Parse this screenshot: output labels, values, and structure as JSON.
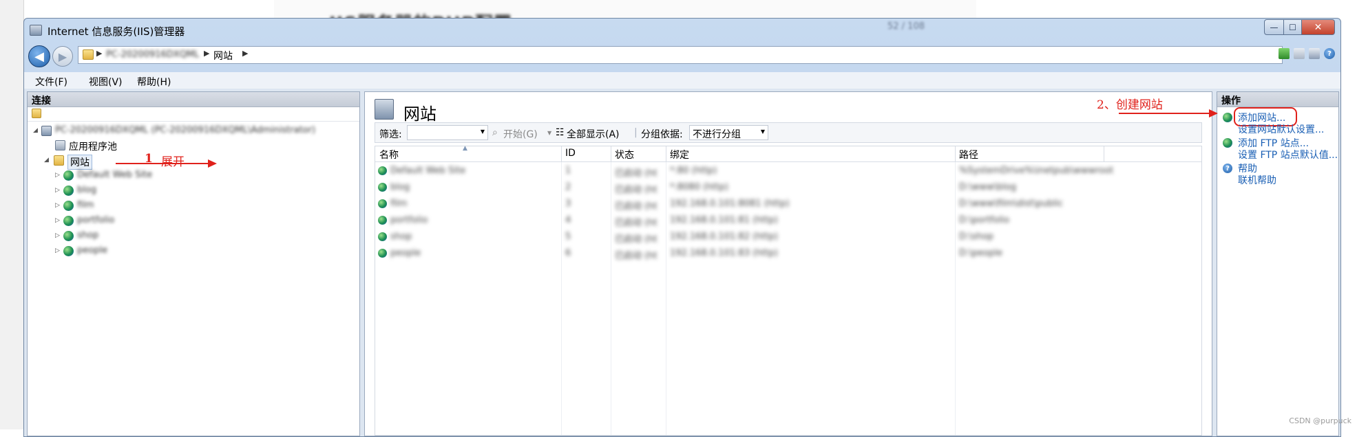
{
  "background": {
    "doc_title": "IIS服务器的PHP配置",
    "doc_page": "52 / 108"
  },
  "window": {
    "title": "Internet 信息服务(IIS)管理器",
    "buttons": {
      "minimize": "—",
      "maximize": "☐",
      "close": "✕"
    }
  },
  "address": {
    "pc_name": "PC-20200916DXQML",
    "site": "网站"
  },
  "menu": {
    "file": "文件(F)",
    "view": "视图(V)",
    "help": "帮助(H)"
  },
  "connections": {
    "header": "连接",
    "server_node": "PC-20200916DXQML (PC-20200916DXQML\\Administrator)",
    "app_pool": "应用程序池",
    "sites": "网站",
    "site_items": [
      "Default Web Site",
      "blog",
      "film",
      "portfolio",
      "shop",
      "people"
    ]
  },
  "annotations": {
    "step1_num": "1",
    "step1_text": "展开",
    "step2_text": "2、创建网站"
  },
  "main": {
    "title": "网站",
    "filter_label": "筛选:",
    "start_label": "开始(G)",
    "show_all_label": "全部显示(A)",
    "group_by_label": "分组依据:",
    "group_by_value": "不进行分组",
    "columns": {
      "name": "名称",
      "id": "ID",
      "status": "状态",
      "binding": "绑定",
      "path": "路径"
    },
    "rows": [
      {
        "name": "Default Web Site",
        "id": "1",
        "status": "已启动 (ht",
        "binding": "*:80 (http)",
        "path": "%SystemDrive%\\inetpub\\wwwroot"
      },
      {
        "name": "blog",
        "id": "2",
        "status": "已启动 (ht",
        "binding": "*:8080 (http)",
        "path": "D:\\www\\blog"
      },
      {
        "name": "film",
        "id": "3",
        "status": "已启动 (ht",
        "binding": "192.168.0.101:8081 (http)",
        "path": "D:\\www\\film\\dist\\public"
      },
      {
        "name": "portfolio",
        "id": "4",
        "status": "已启动 (ht",
        "binding": "192.168.0.101:81 (http)",
        "path": "D:\\portfolio"
      },
      {
        "name": "shop",
        "id": "5",
        "status": "已启动 (ht",
        "binding": "192.168.0.101:82 (http)",
        "path": "D:\\shop"
      },
      {
        "name": "people",
        "id": "6",
        "status": "已启动 (ht",
        "binding": "192.168.0.101:83 (http)",
        "path": "D:\\people"
      }
    ]
  },
  "actions": {
    "header": "操作",
    "add_site": "添加网站...",
    "site_defaults": "设置网站默认设置...",
    "add_ftp": "添加 FTP 站点...",
    "ftp_defaults": "设置 FTP 站点默认值...",
    "help": "帮助",
    "online_help": "联机帮助"
  },
  "watermark": "CSDN @purpuck"
}
